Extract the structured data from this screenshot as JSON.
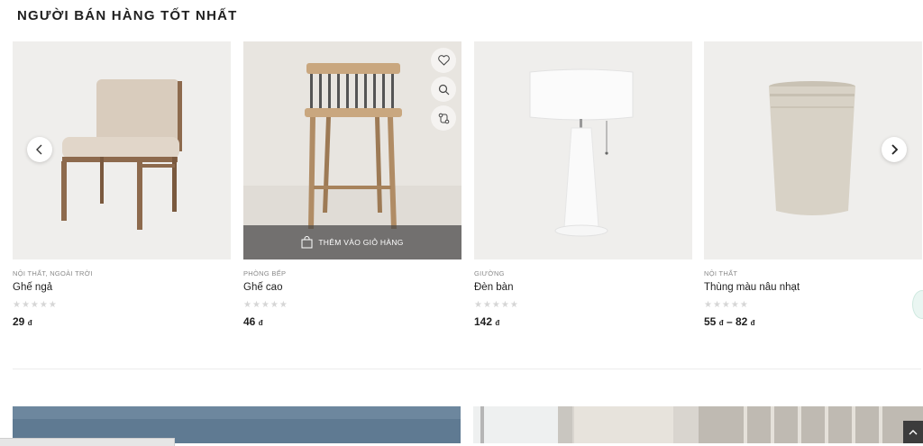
{
  "section": {
    "title": "NGƯỜI BÁN HÀNG TỐT NHẤT"
  },
  "products": [
    {
      "categories": "NỘI THẤT, NGOÀI TRỜI",
      "name": "Ghế ngả",
      "rating_stars": "★★★★★",
      "rating": 0,
      "price": "29",
      "currency": "đ"
    },
    {
      "categories": "PHÒNG BẾP",
      "name": "Ghế cao",
      "rating_stars": "★★★★★",
      "rating": 0,
      "price": "46",
      "currency": "đ",
      "add_to_cart": "THÊM VÀO GIỎ HÀNG"
    },
    {
      "categories": "GIƯỜNG",
      "name": "Đèn bàn",
      "rating_stars": "★★★★★",
      "rating": 0,
      "price": "142",
      "currency": "đ"
    },
    {
      "categories": "NỘI THẤT",
      "name": "Thùng màu nâu nhạt",
      "rating_stars": "★★★★★",
      "rating": 0,
      "price_from": "55",
      "price_sep": "–",
      "price_to": "82",
      "currency": "đ"
    }
  ],
  "icons": {
    "wishlist": "heart-icon",
    "quick_view": "search-icon",
    "compare": "compare-icon",
    "cart": "shopping-bag-icon",
    "prev": "chevron-left-icon",
    "next": "chevron-right-icon",
    "scroll_top": "chevron-up-icon"
  },
  "colors": {
    "text": "#1f1f1f",
    "muted": "#8a8a8a",
    "star_empty": "#d6d6d6",
    "cart_bar": "#464646"
  }
}
